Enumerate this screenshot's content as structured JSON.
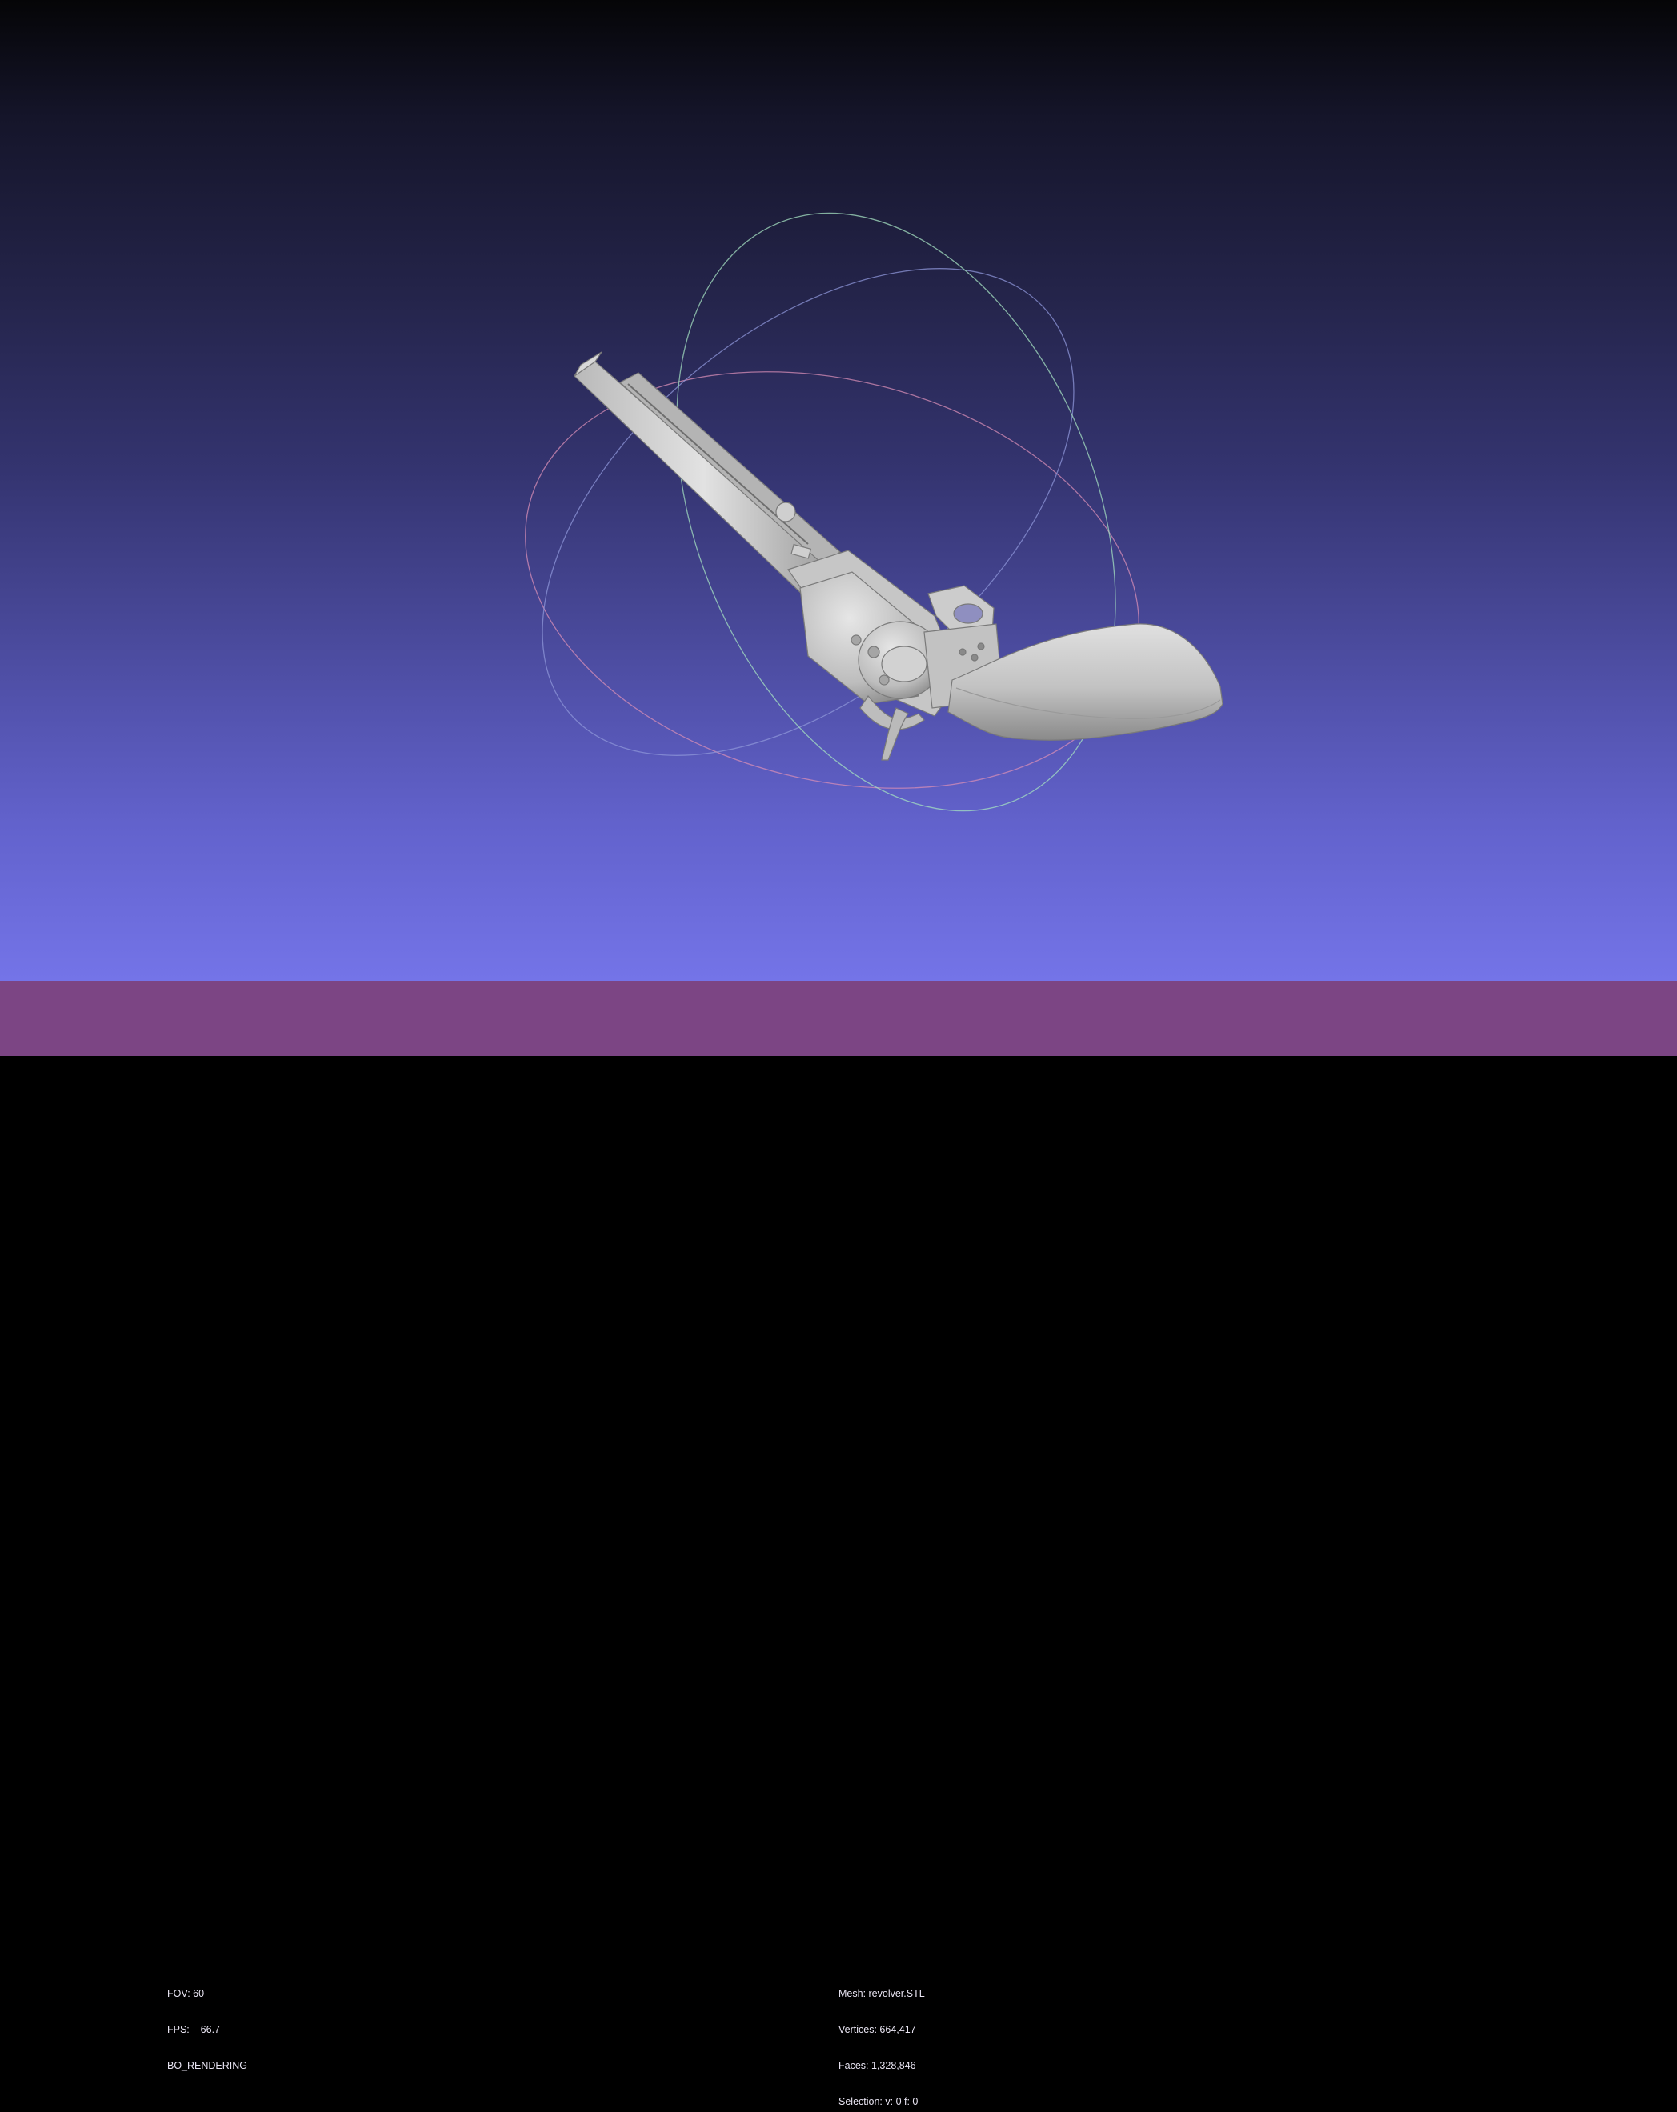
{
  "viewer": {
    "left_info": {
      "fov": "FOV: 60",
      "fps": "FPS:    66.7",
      "mode": "BO_RENDERING"
    },
    "right_info": {
      "mesh": "Mesh: revolver.STL",
      "vertices": "Vertices: 664,417",
      "faces": "Faces: 1,328,846",
      "selection": "Selection: v: 0 f: 0"
    },
    "colors": {
      "status_bar": "#7c4584",
      "background_top": "#050507",
      "background_bottom": "#7474e8",
      "model": "#c8c8c8"
    },
    "model_icon": "revolver-3d-model",
    "gizmo_icon": "trackball-rotation-gizmo"
  }
}
